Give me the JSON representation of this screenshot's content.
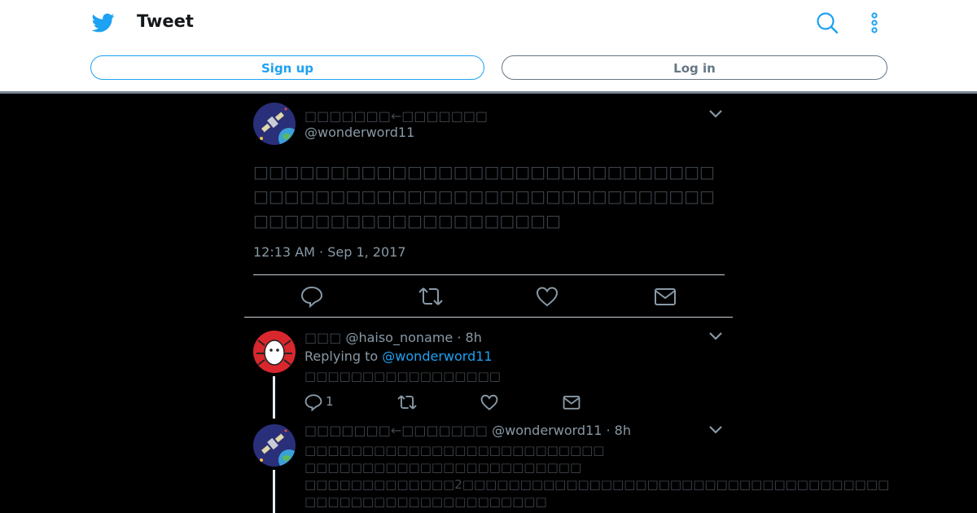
{
  "header": {
    "title": "Tweet",
    "signup_label": "Sign up",
    "login_label": "Log in",
    "brand_color": "#1da1f2",
    "icons": [
      "twitter-bird-icon",
      "search-icon",
      "more-options-icon"
    ]
  },
  "main_tweet": {
    "display_name": "□□□□□□□←□□□□□□□",
    "handle": "@wonderword11",
    "text": "□□□□□□□□□□□□□□□□□□□□□□□□□□□□□□□□□□□□□□□□□□□□□□□□□□□□□□□□□□□□□□□□□□□□□□□□□□□□□□□□",
    "timestamp": "12:13 AM · Sep 1, 2017",
    "actions": [
      "reply-icon",
      "retweet-icon",
      "like-icon",
      "share-icon"
    ]
  },
  "replies": [
    {
      "display_name": "□□□",
      "handle_time": "@haiso_noname · 8h",
      "replying_prefix": "Replying to",
      "replying_to": "@wonderword11",
      "text_lines": [
        "□□□□□□□□□□□□□□□□□"
      ],
      "reply_count": "1"
    },
    {
      "display_name": "□□□□□□□←□□□□□□□",
      "handle_time": "@wonderword11 · 8h",
      "text_lines": [
        "□□□□□□□□□□□□□□□□□□□□□□□□□□",
        "□□□□□□□□□□□□□□□□□□□□□□□□",
        "□□□□□□□□□□□□□2□□□□□□□□□□□□□□□□□□□□□□□□□□□□□□□□□□□□□",
        "□□□□□□□□□□□□□□□□□□□□□"
      ]
    }
  ]
}
